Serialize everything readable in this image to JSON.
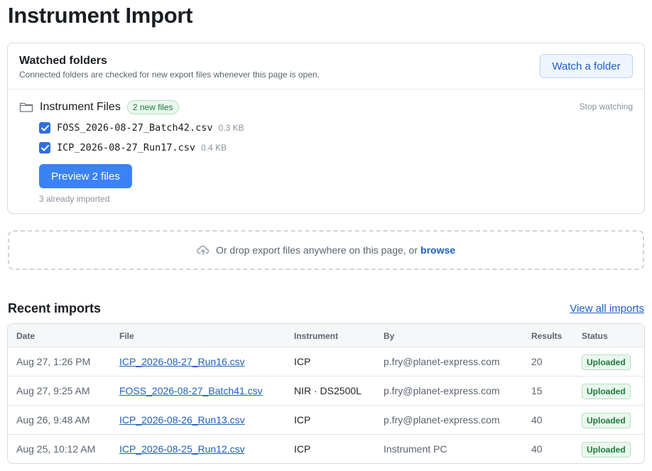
{
  "page": {
    "title": "Instrument Import"
  },
  "watched": {
    "title": "Watched folders",
    "subtitle": "Connected folders are checked for new export files whenever this page is open.",
    "watch_button": "Watch a folder",
    "folder": {
      "name": "Instrument Files",
      "badge": "2 new files",
      "stop_label": "Stop watching",
      "files": [
        {
          "name": "FOSS_2026-08-27_Batch42.csv",
          "size": "0.3 KB",
          "checked": true
        },
        {
          "name": "ICP_2026-08-27_Run17.csv",
          "size": "0.4 KB",
          "checked": true
        }
      ],
      "preview_button": "Preview 2 files",
      "already_imported": "3 already imported"
    }
  },
  "dropzone": {
    "text": "Or drop export files anywhere on this page, or",
    "browse": "browse"
  },
  "recent": {
    "title": "Recent imports",
    "view_all": "View all imports",
    "columns": {
      "date": "Date",
      "file": "File",
      "instrument": "Instrument",
      "by": "By",
      "results": "Results",
      "status": "Status"
    },
    "rows": [
      {
        "date": "Aug 27, 1:26 PM",
        "file": "ICP_2026-08-27_Run16.csv",
        "instrument": "ICP",
        "by": "p.fry@planet-express.com",
        "results": "20",
        "status": "Uploaded"
      },
      {
        "date": "Aug 27, 9:25 AM",
        "file": "FOSS_2026-08-27_Batch41.csv",
        "instrument": "NIR · DS2500L",
        "by": "p.fry@planet-express.com",
        "results": "15",
        "status": "Uploaded"
      },
      {
        "date": "Aug 26, 9:48 AM",
        "file": "ICP_2026-08-26_Run13.csv",
        "instrument": "ICP",
        "by": "p.fry@planet-express.com",
        "results": "40",
        "status": "Uploaded"
      },
      {
        "date": "Aug 25, 10:12 AM",
        "file": "ICP_2026-08-25_Run12.csv",
        "instrument": "ICP",
        "by": "Instrument PC",
        "results": "40",
        "status": "Uploaded"
      }
    ]
  },
  "colors": {
    "accent": "#3b82f6",
    "link": "#1f5fbf",
    "success": "#1c7a3a"
  },
  "icons": {
    "folder": "folder-icon",
    "upload": "cloud-upload-icon",
    "check": "check-icon"
  }
}
